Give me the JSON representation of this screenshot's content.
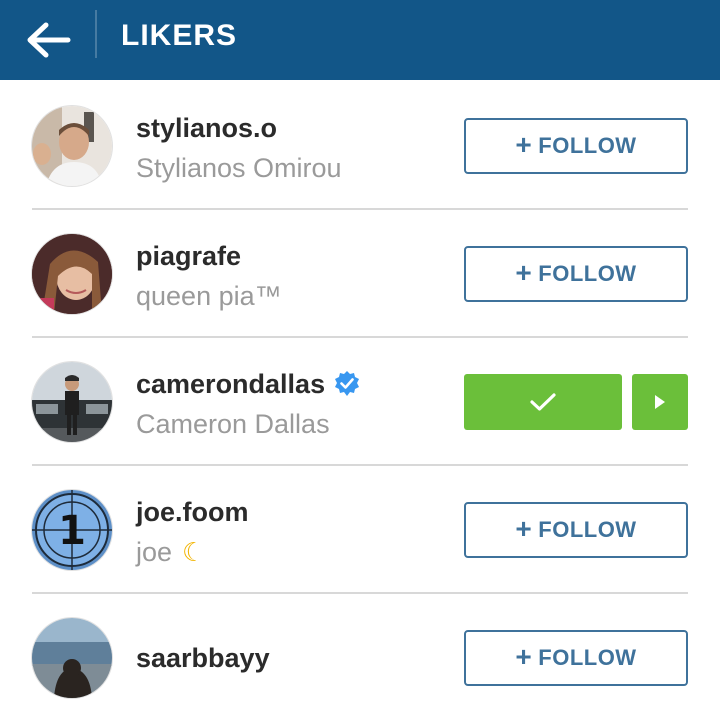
{
  "header": {
    "title": "LIKERS",
    "background": "#125688"
  },
  "colors": {
    "follow_blue": "#3f729b",
    "following_green": "#6bbf3a",
    "verified_blue": "#3897f0"
  },
  "users": [
    {
      "username": "stylianos.o",
      "full_name": "Stylianos Omirou",
      "follow_label": "FOLLOW",
      "state": "not-following"
    },
    {
      "username": "piagrafe",
      "full_name": "queen pia™",
      "follow_label": "FOLLOW",
      "state": "not-following"
    },
    {
      "username": "camerondallas",
      "full_name": "Cameron Dallas",
      "verified": true,
      "state": "following"
    },
    {
      "username": "joe.foom",
      "full_name": "joe",
      "full_name_emoji": "moon-icon",
      "follow_label": "FOLLOW",
      "state": "not-following"
    },
    {
      "username": "saarbbayy",
      "full_name": "",
      "follow_label": "FOLLOW",
      "state": "not-following"
    }
  ]
}
